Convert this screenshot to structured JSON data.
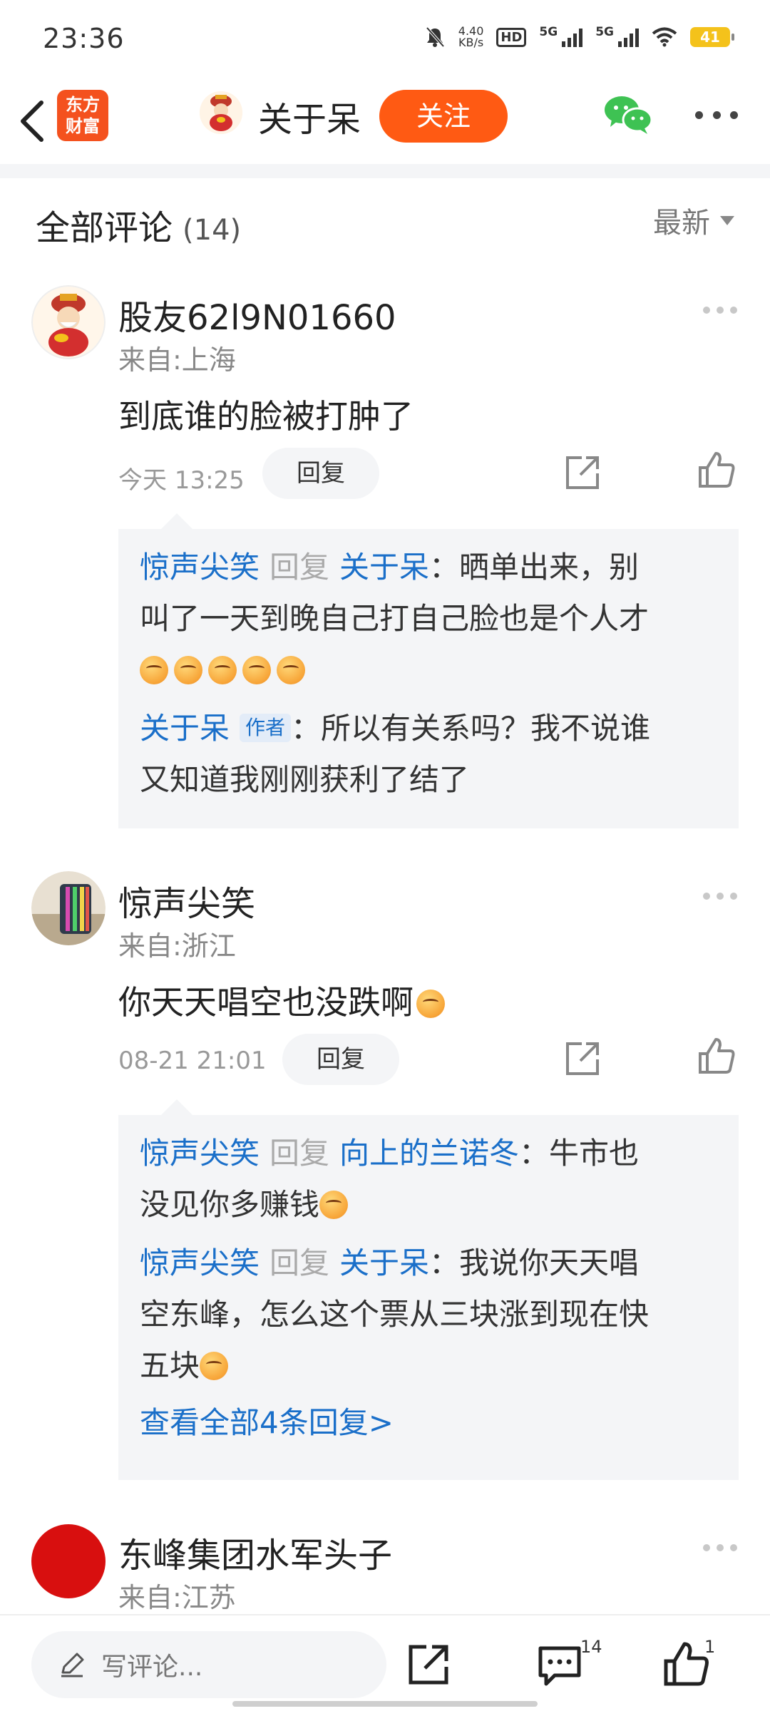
{
  "status_bar": {
    "time": "23:36",
    "net_speed_top": "4.40",
    "net_speed_unit": "KB/s",
    "hd_label": "HD",
    "signal1_label": "5G",
    "signal2_label": "5G",
    "battery": "41"
  },
  "header": {
    "logo_line1": "东方",
    "logo_line2": "财富",
    "title": "关于呆",
    "follow_label": "关注"
  },
  "comments": {
    "title": "全部评论",
    "count": "(14)",
    "sort_label": "最新",
    "items": [
      {
        "name": "股友62l9N01660",
        "location": "来自:上海",
        "text": "到底谁的脸被打肿了",
        "time": "今天 13:25",
        "reply_label": "回复",
        "replies": [
          {
            "user": "惊声尖笑",
            "mid": "回复",
            "target": "关于呆",
            "text_line1": "：晒单出来，别",
            "text_line2": "叫了一天到晚自己打自己脸也是个人才"
          },
          {
            "user": "关于呆",
            "author_tag": "作者",
            "text_line1": "：所以有关系吗？我不说谁",
            "text_line2": "又知道我刚刚获利了结了"
          }
        ]
      },
      {
        "name": "惊声尖笑",
        "location": "来自:浙江",
        "text": "你天天唱空也没跌啊",
        "time": "08-21 21:01",
        "reply_label": "回复",
        "replies": [
          {
            "user": "惊声尖笑",
            "mid": "回复",
            "target": "向上的兰诺冬",
            "text_line1": "：牛市也",
            "text_line2": "没见你多赚钱"
          },
          {
            "user": "惊声尖笑",
            "mid": "回复",
            "target": "关于呆",
            "text_line1": "：我说你天天唱",
            "text_line2": "空东峰，怎么这个票从三块涨到现在快",
            "text_line3": "五块"
          }
        ],
        "more_replies": "查看全部4条回复>"
      },
      {
        "name": "东峰集团水军头子",
        "location": "来自:江苏"
      }
    ]
  },
  "bottom_bar": {
    "write_placeholder": "写评论...",
    "comment_count": "14",
    "like_count": "1"
  },
  "colors": {
    "accent": "#ff5a13",
    "link_blue": "#1a6fc9",
    "logo_red": "#f4511e"
  }
}
